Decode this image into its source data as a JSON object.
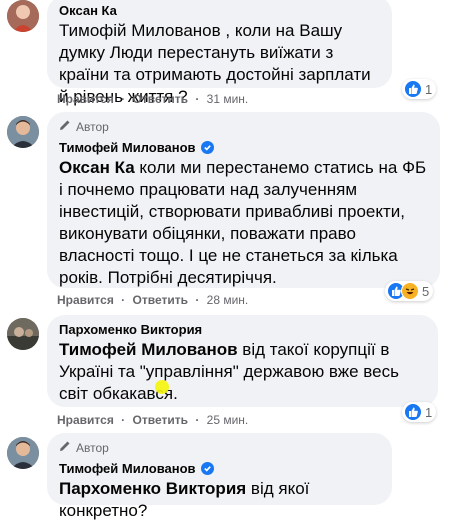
{
  "comments": [
    {
      "author_name": "Оксан Ка",
      "mention": "Тимофій Милованов",
      "body": " , коли на Вашу думку Люди перестануть виїжати з країни та отримають достойні зарплати й рівень життя ?",
      "like_label": "Нравится",
      "reply_label": "Ответить",
      "time": "31 мин.",
      "reaction_count": "1"
    },
    {
      "author_badge": "Автор",
      "author_name": "Тимофей Милованов",
      "mention": "Оксан Ка",
      "body": " коли ми перестанемо статись на ФБ і почнемо працювати над залученням інвестицій, створювати привабливі проекти, виконувати обіцянки, поважати право власності тощо. І це не станеться за кілька років. Потрібні десятиріччя.",
      "like_label": "Нравится",
      "reply_label": "Ответить",
      "time": "28 мин.",
      "reaction_count": "5"
    },
    {
      "author_name": "Пархоменко Виктория",
      "mention": "Тимофей Милованов",
      "body": " від такої корупції в Україні та \"управління\" державою вже весь світ обкакався.",
      "like_label": "Нравится",
      "reply_label": "Ответить",
      "time": "25 мин.",
      "reaction_count": "1"
    },
    {
      "author_badge": "Автор",
      "author_name": "Тимофей Милованов",
      "mention": "Пархоменко Виктория",
      "body": " від якої конкретно?"
    }
  ],
  "separator": "·",
  "colors": {
    "bubble": "#f0f2f5",
    "link_blue": "#1877f2",
    "meta_gray": "#65676b"
  }
}
